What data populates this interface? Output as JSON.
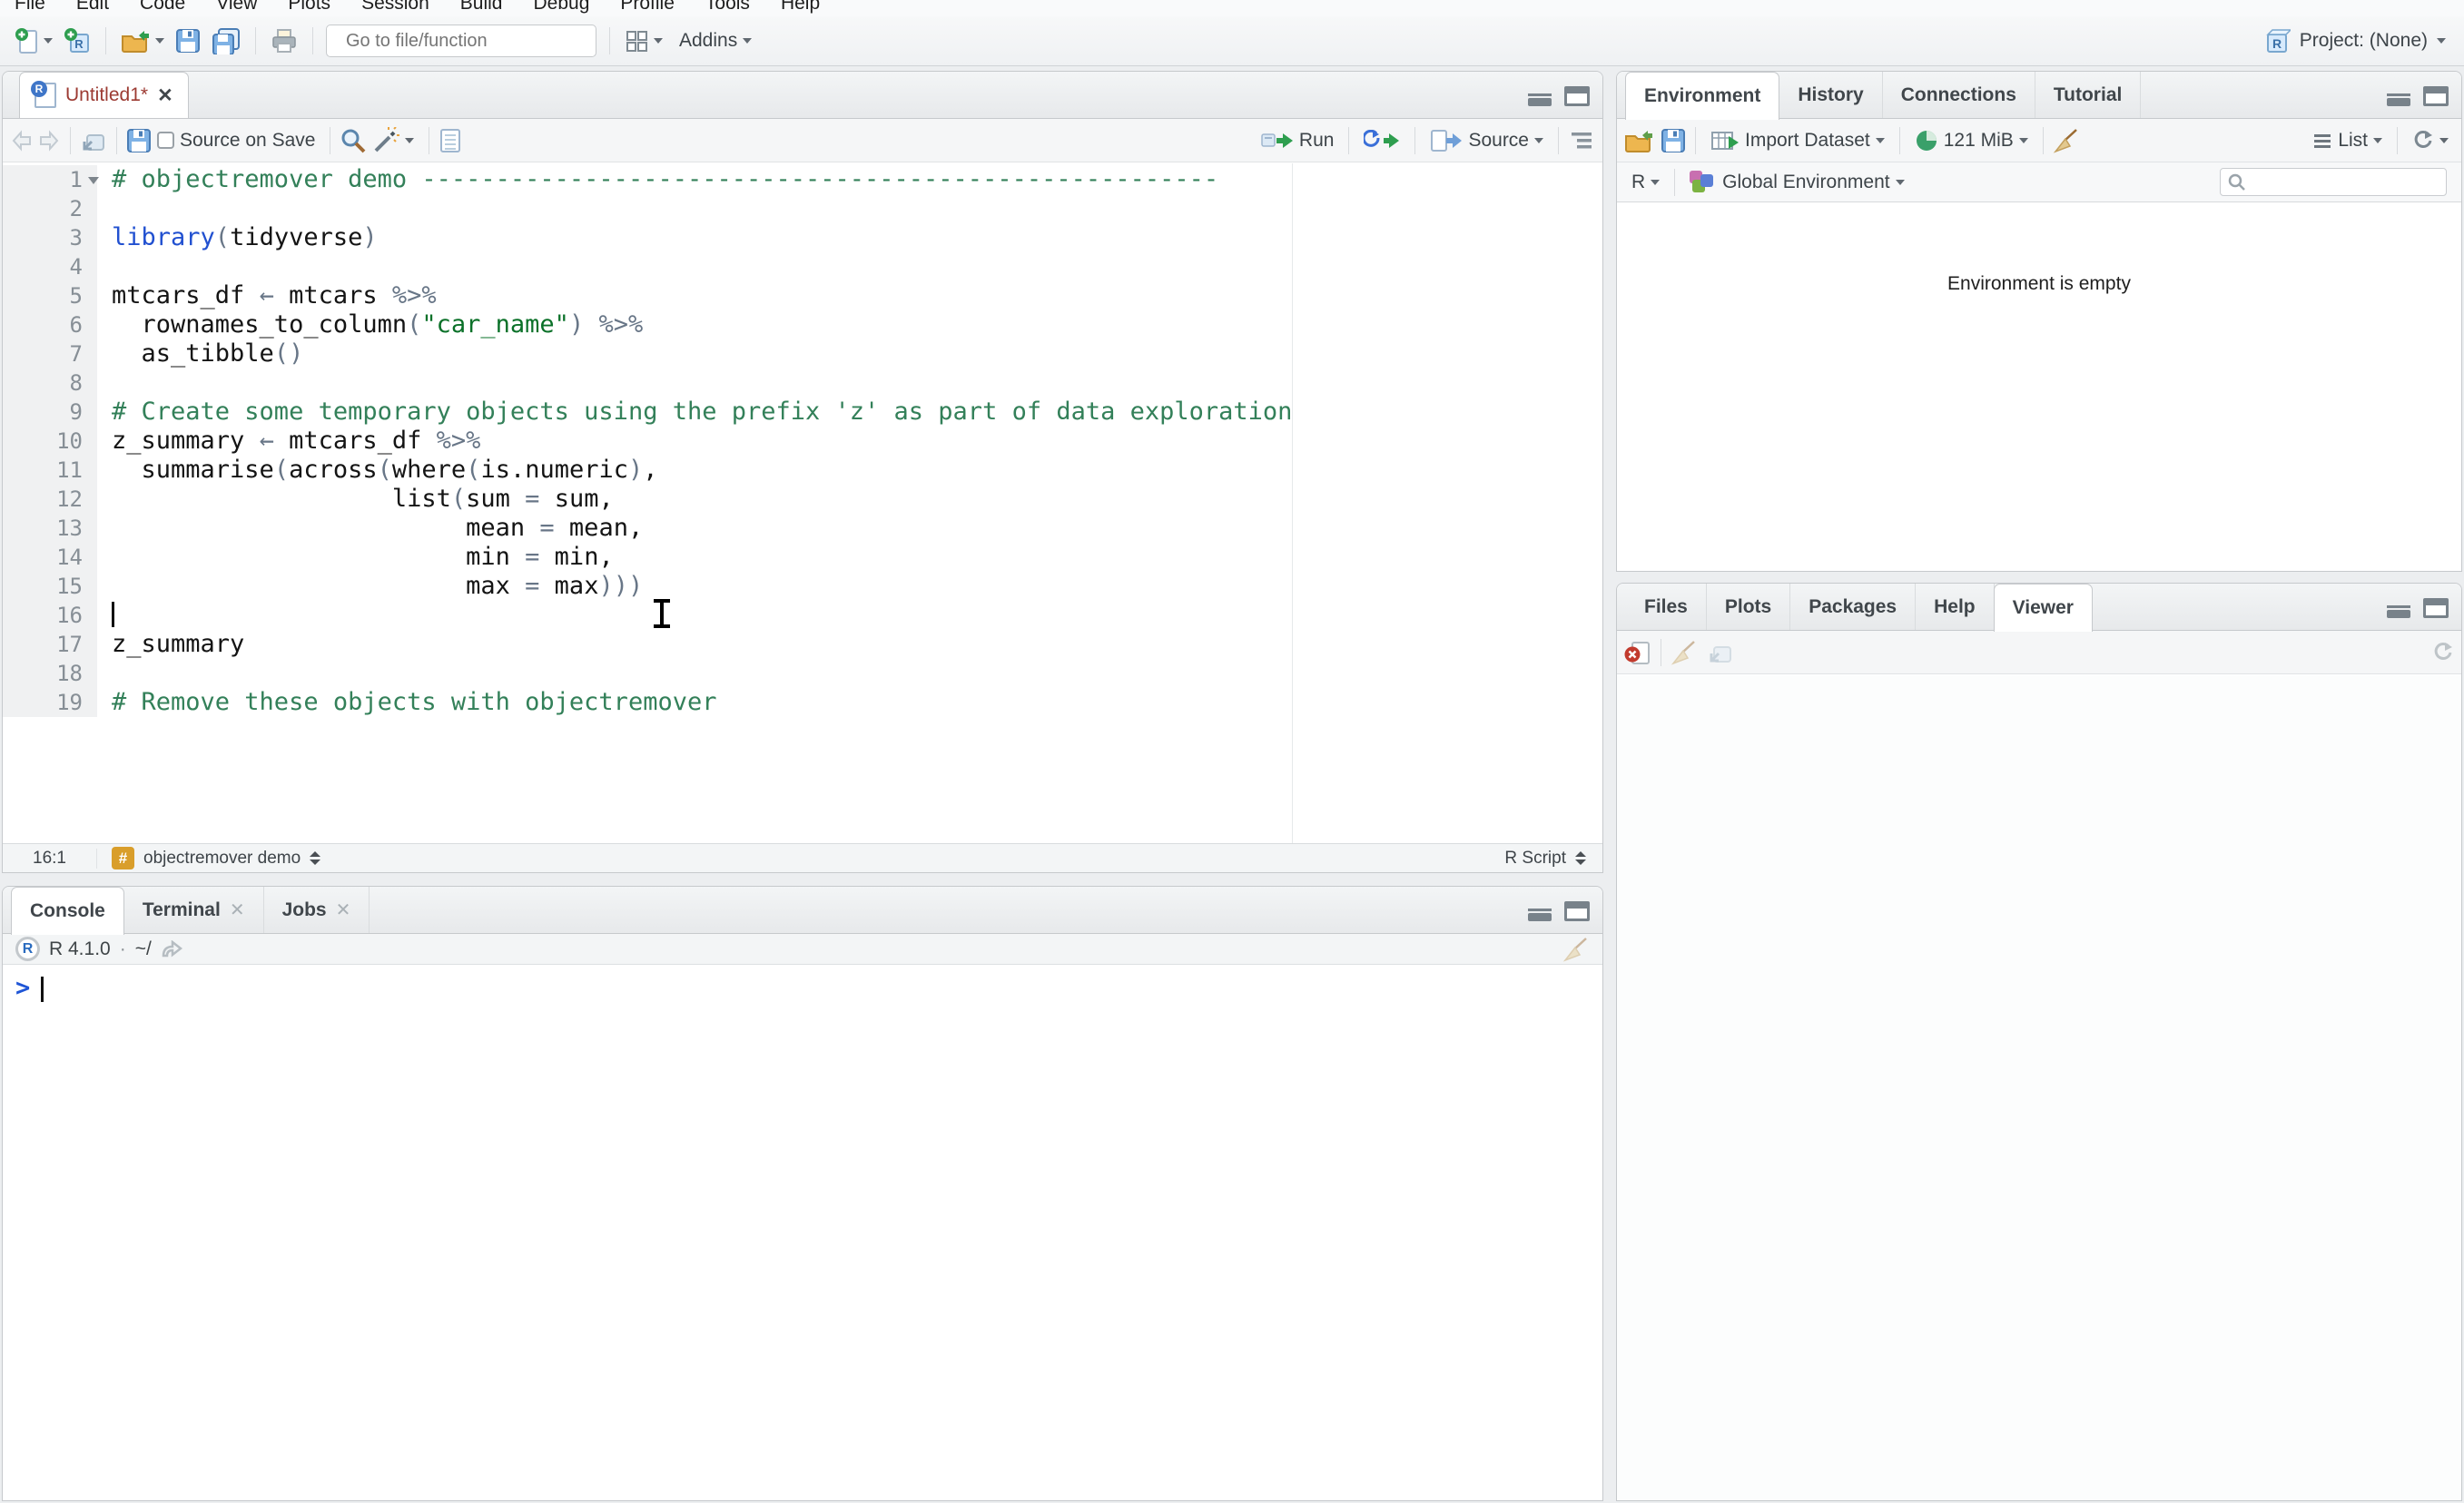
{
  "colors": {
    "comment": "#338059",
    "keyword": "#2150d0",
    "string": "#0b7129",
    "operator": "#687687",
    "text": "#141414",
    "prompt": "#1f55d6",
    "modified": "#9c3a32",
    "badge": "#d99e2b"
  },
  "menu": {
    "items": [
      "File",
      "Edit",
      "Code",
      "View",
      "Plots",
      "Session",
      "Build",
      "Debug",
      "Profile",
      "Tools",
      "Help"
    ]
  },
  "toolbar": {
    "goto_placeholder": "Go to file/function",
    "addins_label": "Addins",
    "project_label": "Project: (None)"
  },
  "editor": {
    "tab_title": "Untitled1*",
    "source_on_save": "Source on Save",
    "run_label": "Run",
    "source_label": "Source",
    "status": {
      "position": "16:1",
      "section": "objectremover demo",
      "file_type": "R Script"
    },
    "code_lines": [
      {
        "n": 1,
        "fold": true,
        "segs": [
          [
            "cm",
            "# objectremover demo ------------------------------------------------------"
          ]
        ]
      },
      {
        "n": 2,
        "segs": []
      },
      {
        "n": 3,
        "segs": [
          [
            "kw",
            "library"
          ],
          [
            "op",
            "("
          ],
          [
            "tx",
            "tidyverse"
          ],
          [
            "op",
            ")"
          ]
        ]
      },
      {
        "n": 4,
        "segs": []
      },
      {
        "n": 5,
        "segs": [
          [
            "tx",
            "mtcars_df "
          ],
          [
            "op",
            "←"
          ],
          [
            "tx",
            " mtcars "
          ],
          [
            "op",
            "%>%"
          ]
        ]
      },
      {
        "n": 6,
        "segs": [
          [
            "tx",
            "  rownames_to_column"
          ],
          [
            "op",
            "("
          ],
          [
            "st",
            "\"car_name\""
          ],
          [
            "op",
            ")"
          ],
          [
            "tx",
            " "
          ],
          [
            "op",
            "%>%"
          ]
        ]
      },
      {
        "n": 7,
        "segs": [
          [
            "tx",
            "  as_tibble"
          ],
          [
            "op",
            "()"
          ]
        ]
      },
      {
        "n": 8,
        "segs": []
      },
      {
        "n": 9,
        "segs": [
          [
            "cm",
            "# Create some temporary objects using the prefix 'z' as part of data exploration"
          ]
        ]
      },
      {
        "n": 10,
        "segs": [
          [
            "tx",
            "z_summary "
          ],
          [
            "op",
            "←"
          ],
          [
            "tx",
            " mtcars_df "
          ],
          [
            "op",
            "%>%"
          ]
        ]
      },
      {
        "n": 11,
        "segs": [
          [
            "tx",
            "  summarise"
          ],
          [
            "op",
            "("
          ],
          [
            "tx",
            "across"
          ],
          [
            "op",
            "("
          ],
          [
            "tx",
            "where"
          ],
          [
            "op",
            "("
          ],
          [
            "tx",
            "is.numeric"
          ],
          [
            "op",
            ")"
          ],
          [
            "tx",
            ","
          ]
        ]
      },
      {
        "n": 12,
        "segs": [
          [
            "tx",
            "                   list"
          ],
          [
            "op",
            "("
          ],
          [
            "tx",
            "sum "
          ],
          [
            "op",
            "="
          ],
          [
            "tx",
            " sum,"
          ]
        ]
      },
      {
        "n": 13,
        "segs": [
          [
            "tx",
            "                        mean "
          ],
          [
            "op",
            "="
          ],
          [
            "tx",
            " mean,"
          ]
        ]
      },
      {
        "n": 14,
        "segs": [
          [
            "tx",
            "                        min "
          ],
          [
            "op",
            "="
          ],
          [
            "tx",
            " min,"
          ]
        ]
      },
      {
        "n": 15,
        "segs": [
          [
            "tx",
            "                        max "
          ],
          [
            "op",
            "="
          ],
          [
            "tx",
            " max"
          ],
          [
            "op",
            ")))"
          ]
        ]
      },
      {
        "n": 16,
        "cursor": true,
        "segs": []
      },
      {
        "n": 17,
        "segs": [
          [
            "tx",
            "z_summary"
          ]
        ]
      },
      {
        "n": 18,
        "segs": []
      },
      {
        "n": 19,
        "segs": [
          [
            "cm",
            "# Remove these objects with objectremover"
          ]
        ]
      }
    ]
  },
  "console": {
    "tabs": [
      {
        "label": "Console",
        "active": true
      },
      {
        "label": "Terminal",
        "closable": true
      },
      {
        "label": "Jobs",
        "closable": true
      }
    ],
    "r_version": "R 4.1.0",
    "separator": "·",
    "working_dir": "~/",
    "prompt": ">"
  },
  "environment": {
    "tabs": [
      {
        "label": "Environment",
        "active": true
      },
      {
        "label": "History"
      },
      {
        "label": "Connections"
      },
      {
        "label": "Tutorial"
      }
    ],
    "import_label": "Import Dataset",
    "memory_label": "121 MiB",
    "list_label": "List",
    "lang_label": "R",
    "scope_label": "Global Environment",
    "empty_text": "Environment is empty"
  },
  "files": {
    "tabs": [
      {
        "label": "Files"
      },
      {
        "label": "Plots"
      },
      {
        "label": "Packages"
      },
      {
        "label": "Help"
      },
      {
        "label": "Viewer",
        "active": true
      }
    ]
  }
}
